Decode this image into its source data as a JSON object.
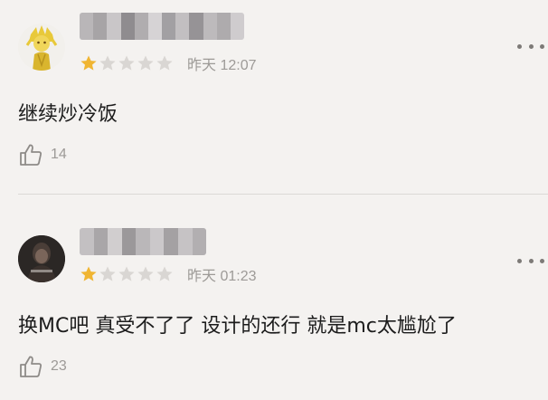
{
  "reviews": [
    {
      "username": "",
      "rating": 1,
      "max_rating": 5,
      "time": "昨天 12:07",
      "content": "继续炒冷饭",
      "like_count": "14"
    },
    {
      "username": "",
      "rating": 1,
      "max_rating": 5,
      "time": "昨天 01:23",
      "content": "换MC吧 真受不了了 设计的还行 就是mc太尴尬了",
      "like_count": "23"
    }
  ],
  "colors": {
    "background": "#f4f2f0",
    "star_filled": "#f0b532",
    "star_empty": "#d9d6d3",
    "meta_text": "#9d9a97",
    "divider": "#dcd9d6"
  },
  "icons": {
    "more": "more-dots-icon",
    "like": "thumbs-up-icon",
    "star": "star-icon"
  }
}
